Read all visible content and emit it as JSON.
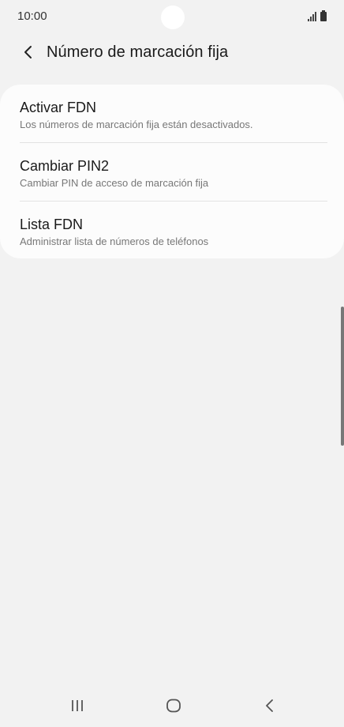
{
  "status_bar": {
    "time": "10:00"
  },
  "app_bar": {
    "title": "Número de marcación fija"
  },
  "items": [
    {
      "title": "Activar FDN",
      "subtitle": "Los números de marcación fija están desactivados."
    },
    {
      "title": "Cambiar PIN2",
      "subtitle": "Cambiar PIN de acceso de marcación fija"
    },
    {
      "title": "Lista FDN",
      "subtitle": "Administrar lista de números de teléfonos"
    }
  ],
  "icons": {
    "back": "back-chevron-icon",
    "signal": "signal-icon",
    "battery": "battery-icon",
    "recents": "recents-icon",
    "home": "home-icon",
    "nav_back": "nav-back-icon"
  },
  "colors": {
    "background": "#f2f2f2",
    "card": "#fcfcfc",
    "primary_text": "#1a1a1a",
    "secondary_text": "#777777"
  }
}
